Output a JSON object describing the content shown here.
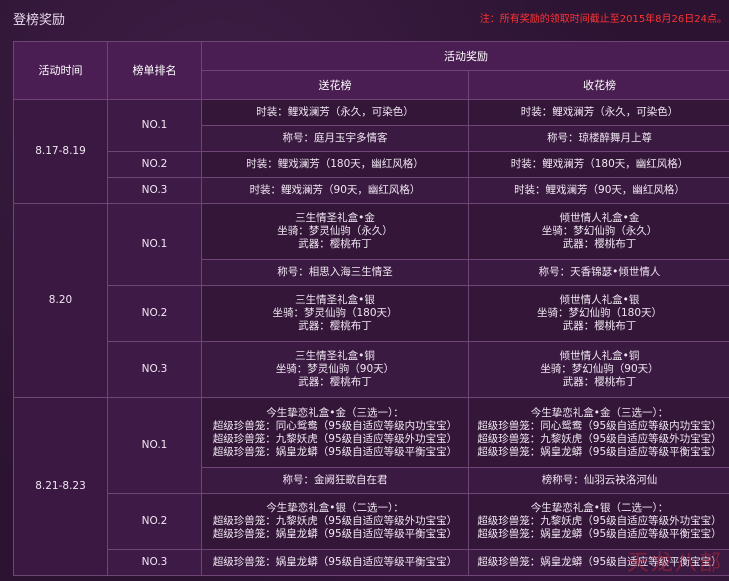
{
  "page": {
    "title": "登榜奖励",
    "note": "注：所有奖励的领取时间截止至2015年8月26日24点。"
  },
  "table": {
    "headers": {
      "time": "活动时间",
      "rank": "榜单排名",
      "award": "活动奖励",
      "send": "送花榜",
      "receive": "收花榜"
    },
    "periods": [
      {
        "time": "8.17-8.19",
        "rows": [
          {
            "rank": "NO.1",
            "send": [
              "时装：鲤戏澜芳（永久，可染色）"
            ],
            "receive": [
              "时装：鲤戏澜芳（永久，可染色）"
            ]
          },
          {
            "rank": "",
            "send": [
              "称号：庭月玉宇多情客"
            ],
            "receive": [
              "称号：琼楼醉舞月上尊"
            ]
          },
          {
            "rank": "NO.2",
            "send": [
              "时装：鲤戏澜芳（180天，幽红风格）"
            ],
            "receive": [
              "时装：鲤戏澜芳（180天，幽红风格）"
            ]
          },
          {
            "rank": "NO.3",
            "send": [
              "时装：鲤戏澜芳（90天，幽红风格）"
            ],
            "receive": [
              "时装：鲤戏澜芳（90天，幽红风格）"
            ]
          }
        ]
      },
      {
        "time": "8.20",
        "rows": [
          {
            "rank": "NO.1",
            "send": [
              "三生情圣礼盒•金",
              "坐骑：梦灵仙驹（永久）",
              "武器：樱桃布丁"
            ],
            "receive": [
              "倾世情人礼盒•金",
              "坐骑：梦幻仙驹（永久）",
              "武器：樱桃布丁"
            ]
          },
          {
            "rank": "",
            "send": [
              "称号：相思入海三生情圣"
            ],
            "receive": [
              "称号：天香锦瑟•倾世情人"
            ]
          },
          {
            "rank": "NO.2",
            "send": [
              "三生情圣礼盒•银",
              "坐骑：梦灵仙驹（180天）",
              "武器：樱桃布丁"
            ],
            "receive": [
              "倾世情人礼盒•银",
              "坐骑：梦幻仙驹（180天）",
              "武器：樱桃布丁"
            ]
          },
          {
            "rank": "NO.3",
            "send": [
              "三生情圣礼盒•铜",
              "坐骑：梦灵仙驹（90天）",
              "武器：樱桃布丁"
            ],
            "receive": [
              "倾世情人礼盒•铜",
              "坐骑：梦幻仙驹（90天）",
              "武器：樱桃布丁"
            ]
          }
        ]
      },
      {
        "time": "8.21-8.23",
        "rows": [
          {
            "rank": "NO.1",
            "send": [
              "今生挚恋礼盒•金（三选一）：",
              "超级珍兽笼：同心鸳鸯（95级自适应等级内功宝宝）",
              "超级珍兽笼：九黎妖虎（95级自适应等级外功宝宝）",
              "超级珍兽笼：娲皇龙蟒（95级自适应等级平衡宝宝）"
            ],
            "receive": [
              "今生挚恋礼盒•金（三选一）：",
              "超级珍兽笼：同心鸳鸯（95级自适应等级内功宝宝）",
              "超级珍兽笼：九黎妖虎（95级自适应等级外功宝宝）",
              "超级珍兽笼：娲皇龙蟒（95级自适应等级平衡宝宝）"
            ]
          },
          {
            "rank": "",
            "send": [
              "称号：金阙狂歌自在君"
            ],
            "receive": [
              "榜称号：仙羽云袂洛河仙"
            ]
          },
          {
            "rank": "NO.2",
            "send": [
              "今生挚恋礼盒•银（二选一）：",
              "超级珍兽笼：九黎妖虎（95级自适应等级外功宝宝）",
              "超级珍兽笼：娲皇龙蟒（95级自适应等级平衡宝宝）"
            ],
            "receive": [
              "今生挚恋礼盒•银（二选一）：",
              "超级珍兽笼：九黎妖虎（95级自适应等级外功宝宝）",
              "超级珍兽笼：娲皇龙蟒（95级自适应等级平衡宝宝）"
            ]
          },
          {
            "rank": "NO.3",
            "send": [
              "超级珍兽笼：娲皇龙蟒（95级自适应等级平衡宝宝）"
            ],
            "receive": [
              "超级珍兽笼：娲皇龙蟒（95级自适应等级平衡宝宝）"
            ]
          }
        ]
      }
    ]
  },
  "watermark": "天龙八部"
}
